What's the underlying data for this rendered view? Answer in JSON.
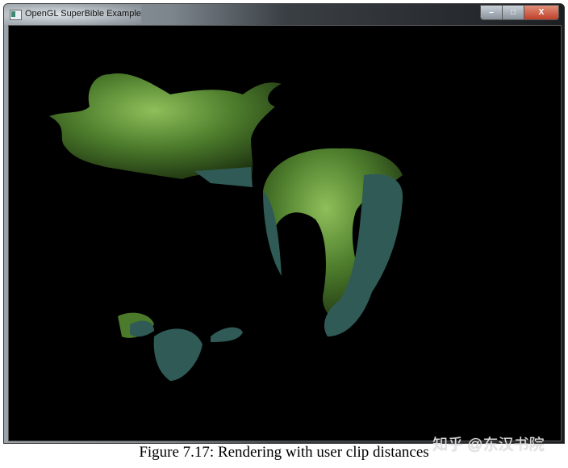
{
  "window": {
    "title": "OpenGL SuperBible Example",
    "controls": {
      "minimize": "–",
      "maximize": "□",
      "close": "X"
    }
  },
  "scene": {
    "colors": {
      "background": "#000000",
      "dragon_skin": "#4a7a2a",
      "clip_cap": "#2f5a55"
    }
  },
  "caption": "Figure 7.17: Rendering with user clip distances",
  "watermark": "知乎 @东汉书院"
}
